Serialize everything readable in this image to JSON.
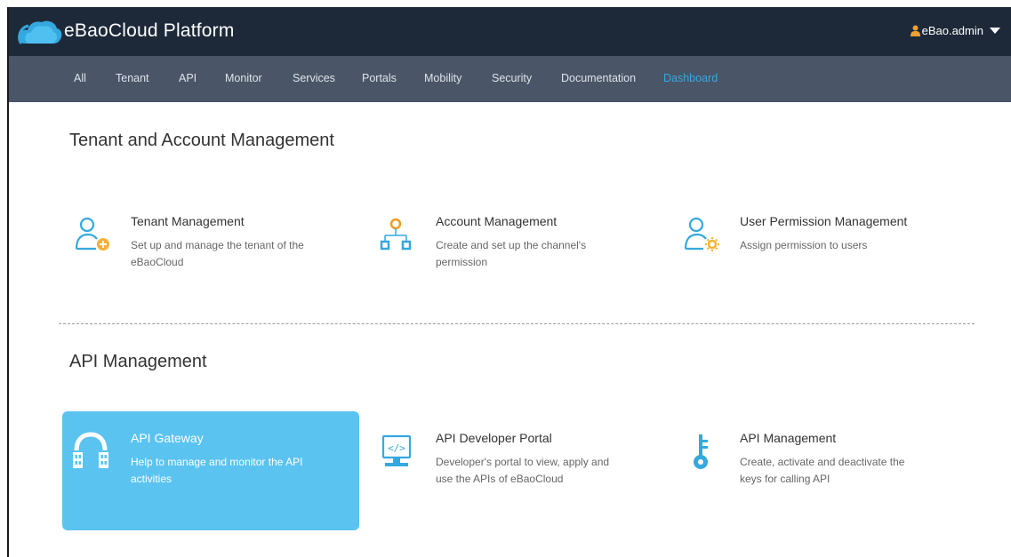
{
  "header": {
    "brand": "eBaoCloud Platform",
    "user": "eBao.admin",
    "colors": {
      "bar": "#1d2939",
      "logo": "#35a8e0",
      "user_icon": "#f0a030"
    }
  },
  "nav": {
    "items": [
      {
        "label": "All"
      },
      {
        "label": "Tenant"
      },
      {
        "label": "API"
      },
      {
        "label": "Monitor"
      },
      {
        "label": "Services"
      },
      {
        "label": "Portals"
      },
      {
        "label": "Mobility"
      },
      {
        "label": "Security"
      },
      {
        "label": "Documentation"
      },
      {
        "label": "Dashboard",
        "active": true
      }
    ],
    "colors": {
      "bar": "#4a5567",
      "active": "#35a8e0"
    }
  },
  "sections": [
    {
      "title": "Tenant and Account Management",
      "cards": [
        {
          "icon": "user-add-icon",
          "title": "Tenant Management",
          "description": "Set up and manage the tenant of the eBaoCloud"
        },
        {
          "icon": "org-chart-icon",
          "title": "Account Management",
          "description": "Create and set up the channel's permission"
        },
        {
          "icon": "user-settings-icon",
          "title": "User Permission Management",
          "description": "Assign permission to users"
        }
      ]
    },
    {
      "title": "API Management",
      "cards": [
        {
          "icon": "gateway-icon",
          "title": "API Gateway",
          "description": "Help to manage and monitor the API activities",
          "highlighted": true
        },
        {
          "icon": "code-monitor-icon",
          "title": "API Developer Portal",
          "description": "Developer's portal to view, apply and use the APIs of eBaoCloud"
        },
        {
          "icon": "key-icon",
          "title": "API Management",
          "description": "Create, activate and deactivate the keys for calling API"
        }
      ]
    }
  ]
}
